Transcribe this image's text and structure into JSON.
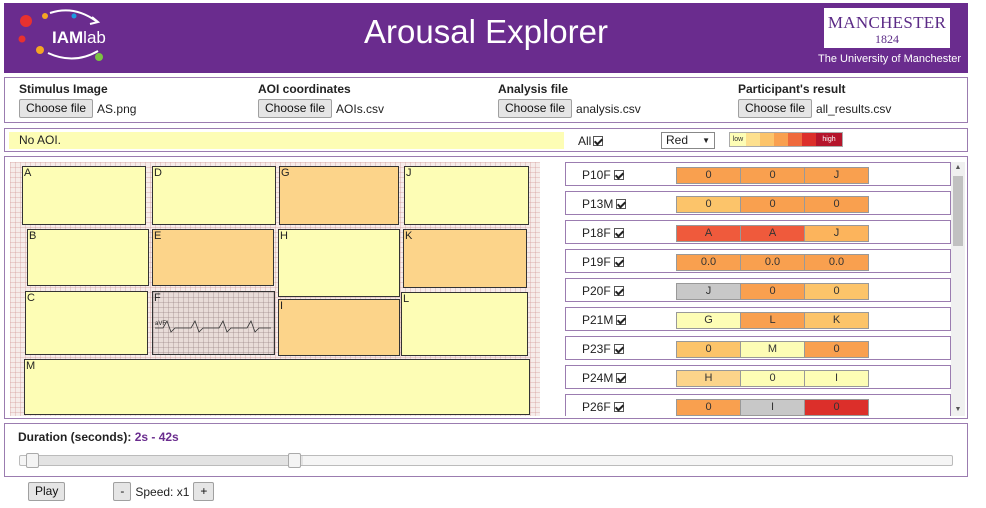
{
  "header": {
    "logo_main": "IAM",
    "logo_lab": "lab",
    "title": "Arousal Explorer",
    "uni_name": "MANCHESTER",
    "uni_year": "1824",
    "uni_sub": "The University of Manchester",
    "bg_color": "#6a2c8e"
  },
  "files": {
    "stimulus": {
      "label": "Stimulus Image",
      "button": "Choose file",
      "file": "AS.png"
    },
    "aoi": {
      "label": "AOI coordinates",
      "button": "Choose file",
      "file": "AOIs.csv"
    },
    "analysis": {
      "label": "Analysis file",
      "button": "Choose file",
      "file": "analysis.csv"
    },
    "result": {
      "label": "Participant's result",
      "button": "Choose file",
      "file": "all_results.csv"
    }
  },
  "aoi_bar": {
    "message": "No AOI.",
    "all_label": "All",
    "color_select": "Red",
    "legend_low": "low",
    "legend_high": "high",
    "legend_colors": [
      "#fdfdb5",
      "#fde08e",
      "#fcc46a",
      "#f9a04f",
      "#ef6a3c",
      "#dc2f2a",
      "#b5152b"
    ]
  },
  "aois": [
    {
      "label": "A",
      "color": "#fdfdb5"
    },
    {
      "label": "D",
      "color": "#fdfdb5"
    },
    {
      "label": "G",
      "color": "#fcd48a"
    },
    {
      "label": "J",
      "color": "#fdfdb5"
    },
    {
      "label": "B",
      "color": "#fdfdb5"
    },
    {
      "label": "E",
      "color": "#fcd48a"
    },
    {
      "label": "H",
      "color": "#fdfdb5"
    },
    {
      "label": "K",
      "color": "#fcd48a"
    },
    {
      "label": "C",
      "color": "#fdfdb5"
    },
    {
      "label": "F",
      "color": "#e8dcd8"
    },
    {
      "label": "I",
      "color": "#fcd48a"
    },
    {
      "label": "L",
      "color": "#fdfdb5"
    },
    {
      "label": "M",
      "color": "#fdfdb5"
    }
  ],
  "ecg_lead_label": "aVF",
  "participants": [
    {
      "name": "P10F",
      "cells": [
        {
          "v": "0",
          "c": "#f9a04f"
        },
        {
          "v": "0",
          "c": "#f9a04f"
        },
        {
          "v": "J",
          "c": "#f9a04f"
        }
      ]
    },
    {
      "name": "P13M",
      "cells": [
        {
          "v": "0",
          "c": "#fcc46a"
        },
        {
          "v": "0",
          "c": "#f9a04f"
        },
        {
          "v": "0",
          "c": "#f9a04f"
        }
      ]
    },
    {
      "name": "P18F",
      "cells": [
        {
          "v": "A",
          "c": "#ef5a3c"
        },
        {
          "v": "A",
          "c": "#ef5a3c"
        },
        {
          "v": "J",
          "c": "#fcb45c"
        }
      ]
    },
    {
      "name": "P19F",
      "cells": [
        {
          "v": "0.0",
          "c": "#f9a04f"
        },
        {
          "v": "0.0",
          "c": "#f9a04f"
        },
        {
          "v": "0.0",
          "c": "#f9a04f"
        }
      ]
    },
    {
      "name": "P20F",
      "cells": [
        {
          "v": "J",
          "c": "#c8c8c8"
        },
        {
          "v": "0",
          "c": "#f9a04f"
        },
        {
          "v": "0",
          "c": "#fcc46a"
        }
      ]
    },
    {
      "name": "P21M",
      "cells": [
        {
          "v": "G",
          "c": "#fdfdb5"
        },
        {
          "v": "L",
          "c": "#f9a04f"
        },
        {
          "v": "K",
          "c": "#fcc46a"
        }
      ]
    },
    {
      "name": "P23F",
      "cells": [
        {
          "v": "0",
          "c": "#fcc46a"
        },
        {
          "v": "M",
          "c": "#fdfdb5"
        },
        {
          "v": "0",
          "c": "#f9a04f"
        }
      ]
    },
    {
      "name": "P24M",
      "cells": [
        {
          "v": "H",
          "c": "#fcd48a"
        },
        {
          "v": "0",
          "c": "#fdfdb5"
        },
        {
          "v": "I",
          "c": "#fdfdb5"
        }
      ]
    },
    {
      "name": "P26F",
      "cells": [
        {
          "v": "0",
          "c": "#f9a04f"
        },
        {
          "v": "I",
          "c": "#c8c8c8"
        },
        {
          "v": "0",
          "c": "#dc2f2a"
        }
      ]
    }
  ],
  "duration": {
    "label": "Duration (seconds):",
    "value": "2s - 42s",
    "range_start_fraction": 0.0,
    "range_end_fraction": 0.3
  },
  "controls": {
    "play": "Play",
    "minus": "-",
    "speed_label": "Speed: x1",
    "plus": "+"
  }
}
